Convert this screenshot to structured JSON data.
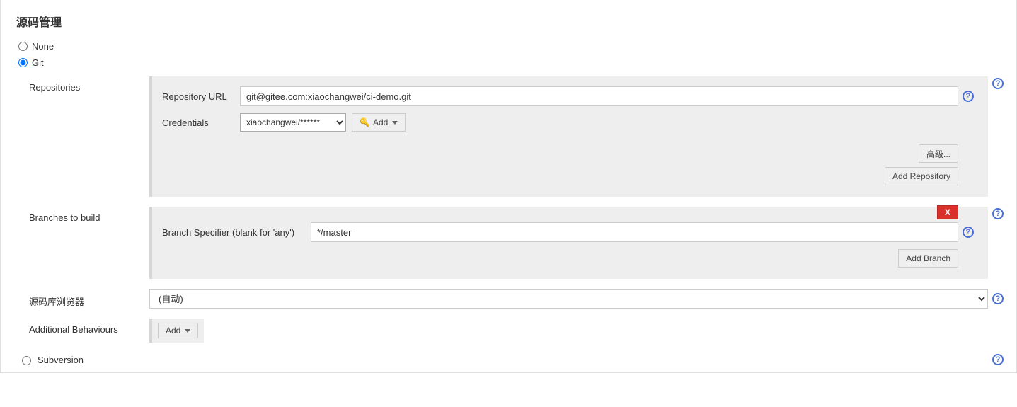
{
  "section_title": "源码管理",
  "scm": {
    "none_label": "None",
    "git_label": "Git",
    "subversion_label": "Subversion",
    "selected": "git"
  },
  "git": {
    "repositories_label": "Repositories",
    "repo_url_label": "Repository URL",
    "repo_url_value": "git@gitee.com:xiaochangwei/ci-demo.git",
    "credentials_label": "Credentials",
    "credentials_selected": "xiaochangwei/******",
    "add_credential_btn": "Add",
    "advanced_btn": "高级...",
    "add_repo_btn": "Add Repository",
    "branches_label": "Branches to build",
    "branch_specifier_label": "Branch Specifier (blank for 'any')",
    "branch_specifier_value": "*/master",
    "delete_branch_btn": "X",
    "add_branch_btn": "Add Branch",
    "browser_label": "源码库浏览器",
    "browser_selected": "(自动)",
    "additional_behaviours_label": "Additional Behaviours",
    "add_behaviour_btn": "Add"
  },
  "icons": {
    "help": "?",
    "key": "🔑"
  }
}
